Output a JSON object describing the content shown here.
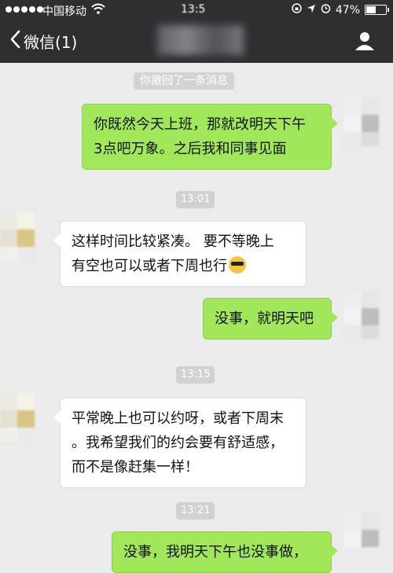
{
  "status_bar": {
    "carrier": "中国移动",
    "time": "13:5",
    "battery": "47%",
    "battery_level": 0.47
  },
  "nav": {
    "back_label": "微信(1)"
  },
  "chat": {
    "recall_notice": "你撤回了一条消息",
    "messages": [
      {
        "from": "me",
        "text": "你既然今天上班，那就改明天下午3点吧万象。之后我和同事见面"
      },
      {
        "timestamp": "13:01"
      },
      {
        "from": "other",
        "text": "这样时间比较紧凑。 要不等晚上有空也可以或者下周也行"
      },
      {
        "from": "me",
        "text": "没事，就明天吧"
      },
      {
        "timestamp": "13:15"
      },
      {
        "from": "other",
        "text": "平常晚上也可以约呀，或者下周末。我希望我们的约会要有舒适感，而不是像赶集一样！"
      },
      {
        "timestamp": "13:21"
      },
      {
        "from": "me",
        "text": "没事，我明天下午也没事做，"
      }
    ],
    "bubble1": {
      "line1": "你既然今天上班，那就改明天下午",
      "line2": "3点吧万象。之后我和同事见面"
    },
    "ts1": "13:01",
    "bubble2": {
      "line1": "这样时间比较紧凑。 要不等晚上",
      "line2": "有空也可以或者下周也行"
    },
    "bubble3": {
      "line1": "没事，就明天吧"
    },
    "ts2": "13:15",
    "bubble4": {
      "line1": "平常晚上也可以约呀，或者下周末",
      "line2": "。我希望我们的约会要有舒适感，",
      "line3": "而不是像赶集一样！"
    },
    "ts3": "13:21",
    "bubble5": {
      "line1": "没事，我明天下午也没事做，"
    }
  },
  "colors": {
    "header_bg": "#2f2f33",
    "chat_bg": "#ebebeb",
    "outgoing_bubble": "#a0e75a",
    "incoming_bubble": "#ffffff",
    "timestamp_bg": "#d1d1d1"
  },
  "icons": {
    "back": "chevron-left-icon",
    "profile": "person-icon",
    "wifi": "wifi-icon",
    "lock": "rotation-lock-icon",
    "location": "location-arrow-icon",
    "alarm": "alarm-icon",
    "emoji": "cool-sunglasses-emoji-icon"
  }
}
